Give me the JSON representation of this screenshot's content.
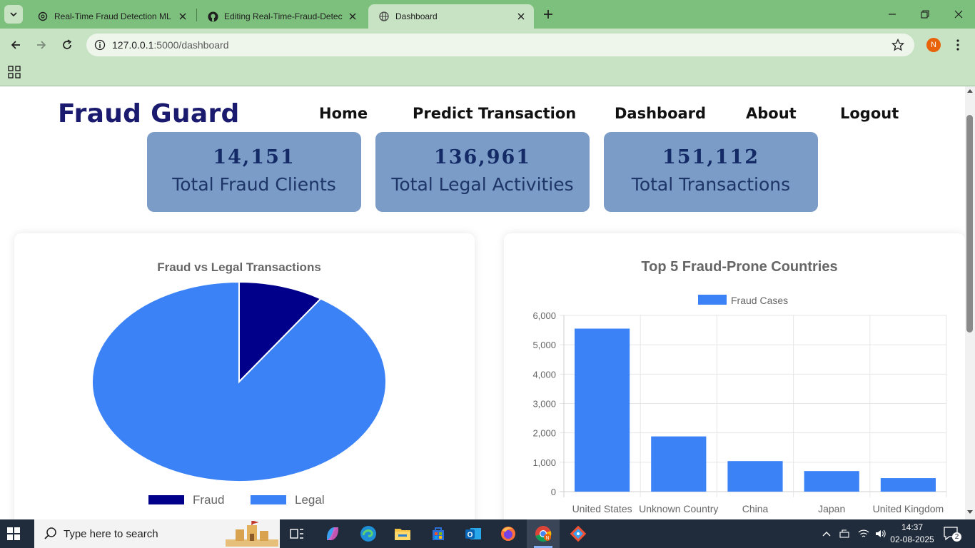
{
  "browser": {
    "tabs": [
      {
        "title": "Real-Time Fraud Detection ML",
        "active": false
      },
      {
        "title": "Editing Real-Time-Fraud-Detect",
        "active": false
      },
      {
        "title": "Dashboard",
        "active": true
      }
    ],
    "url_host": "127.0.0.1",
    "url_path": ":5000/dashboard",
    "profile_initial": "N"
  },
  "site": {
    "brand": "Fraud Guard",
    "nav": [
      "Home",
      "Predict Transaction",
      "Dashboard",
      "About",
      "Logout"
    ]
  },
  "stats": [
    {
      "value": "14,151",
      "label": "Total Fraud Clients"
    },
    {
      "value": "136,961",
      "label": "Total Legal Activities"
    },
    {
      "value": "151,112",
      "label": "Total Transactions"
    }
  ],
  "charts": {
    "pie_title": "Fraud vs Legal Transactions",
    "bar_title": "Top 5 Fraud-Prone Countries",
    "bar_legend": "Fraud Cases"
  },
  "chart_data": [
    {
      "type": "pie",
      "title": "Fraud vs Legal Transactions",
      "categories": [
        "Fraud",
        "Legal"
      ],
      "values": [
        14151,
        136961
      ],
      "colors": [
        "#00008b",
        "#3b82f6"
      ],
      "legend": "bottom"
    },
    {
      "type": "bar",
      "title": "Top 5 Fraud-Prone Countries",
      "categories": [
        "United States",
        "Unknown Country",
        "China",
        "Japan",
        "United Kingdom"
      ],
      "series": [
        {
          "name": "Fraud Cases",
          "values": [
            5550,
            1880,
            1040,
            700,
            460
          ]
        }
      ],
      "ylim": [
        0,
        6000
      ],
      "yticks": [
        "0",
        "1,000",
        "2,000",
        "3,000",
        "4,000",
        "5,000",
        "6,000"
      ],
      "color": "#3b82f6",
      "grid": true,
      "legend": "top"
    }
  ],
  "taskbar": {
    "search_placeholder": "Type here to search",
    "time": "14:37",
    "date": "02-08-2025",
    "notifications": "2"
  }
}
